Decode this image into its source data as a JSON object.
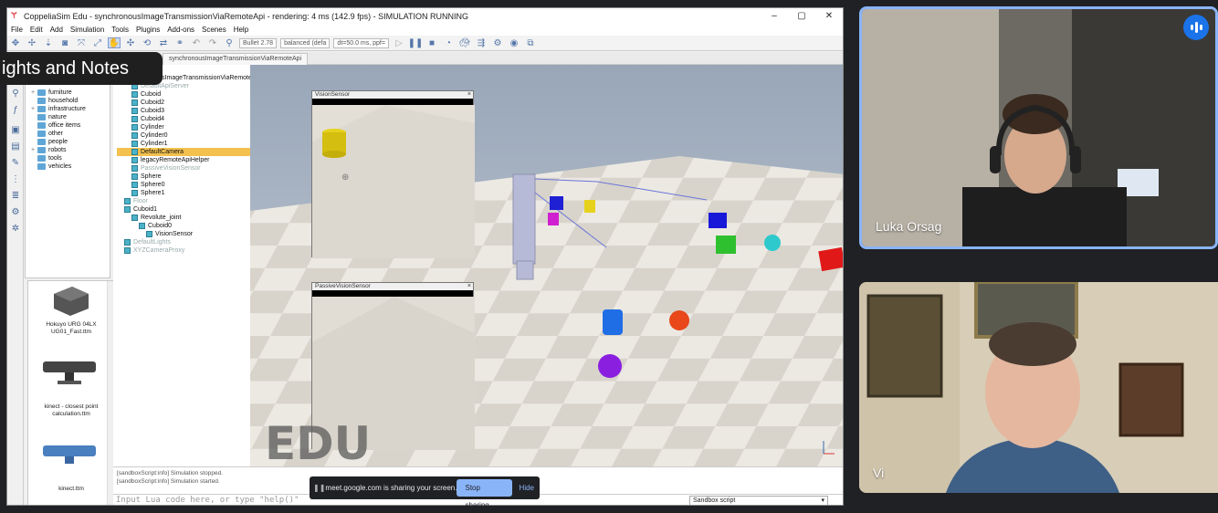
{
  "window": {
    "title": "CoppeliaSim Edu - synchronousImageTransmissionViaRemoteApi - rendering: 4 ms (142.9 fps) - SIMULATION RUNNING",
    "controls": [
      "–",
      "▢",
      "✕"
    ]
  },
  "menu": [
    "File",
    "Edit",
    "Add",
    "Simulation",
    "Tools",
    "Plugins",
    "Add-ons",
    "Scenes",
    "Help"
  ],
  "toolbar": {
    "engine": "Bullet 2.78",
    "mode": "balanced (defa",
    "dt": "dt=50.0 ms, ppf="
  },
  "scene_tab": "synchronousImageTransmissionViaRemoteApi",
  "overlay_pill": "ights and Notes",
  "model_browser": {
    "folders": [
      "furniture",
      "household",
      "infrastructure",
      "nature",
      "office items",
      "other",
      "people",
      "robots",
      "tools",
      "vehicles"
    ]
  },
  "model_thumbs": [
    {
      "label": "Hokuyo URG 04LX UG01_Fast.ttm"
    },
    {
      "label": "kinect - closest point calculation.ttm"
    },
    {
      "label": "kinect.ttm"
    }
  ],
  "scene_hierarchy": [
    {
      "label": "DefaultApiServer",
      "indent": 2,
      "dim": true
    },
    {
      "label": "Cuboid",
      "indent": 2
    },
    {
      "label": "Cuboid2",
      "indent": 2
    },
    {
      "label": "Cuboid3",
      "indent": 2
    },
    {
      "label": "Cuboid4",
      "indent": 2
    },
    {
      "label": "Cylinder",
      "indent": 2
    },
    {
      "label": "Cylinder0",
      "indent": 2
    },
    {
      "label": "Cylinder1",
      "indent": 2
    },
    {
      "label": "DefaultCamera",
      "indent": 2,
      "selected": true
    },
    {
      "label": "legacyRemoteApiHelper",
      "indent": 2
    },
    {
      "label": "PassiveVisionSensor",
      "indent": 2,
      "dim": true
    },
    {
      "label": "Sphere",
      "indent": 2
    },
    {
      "label": "Sphere0",
      "indent": 2
    },
    {
      "label": "Sphere1",
      "indent": 2
    },
    {
      "label": "Floor",
      "indent": 1,
      "dim": true
    },
    {
      "label": "Cuboid1",
      "indent": 1
    },
    {
      "label": "Revolute_joint",
      "indent": 2
    },
    {
      "label": "Cuboid0",
      "indent": 3
    },
    {
      "label": "VisionSensor",
      "indent": 4
    },
    {
      "label": "DefaultLights",
      "indent": 1,
      "dim": true
    },
    {
      "label": "XYZCameraProxy",
      "indent": 1,
      "dim": true
    }
  ],
  "scene_root": "synchronousImageTransmissionViaRemoteA",
  "vision_sensor_title": "VisionSensor",
  "passive_sensor_title": "PassiveVisionSensor",
  "watermark": "EDU",
  "status_lines": [
    "[sandboxScript:info]  Simulation stopped.",
    "[sandboxScript:info]  Simulation started."
  ],
  "lua_placeholder": "Input Lua code here, or type \"help()\"",
  "script_select": "Sandbox script",
  "share_bar": {
    "message": "meet.google.com is sharing your screen.",
    "stop": "Stop sharing",
    "hide": "Hide"
  },
  "participants": [
    {
      "name": "Luka Orsag"
    },
    {
      "name": "Vi"
    }
  ],
  "colors": {
    "meet_blue": "#8ab4f8",
    "selected_row": "#f2c14e",
    "meet_bg": "#202124"
  }
}
